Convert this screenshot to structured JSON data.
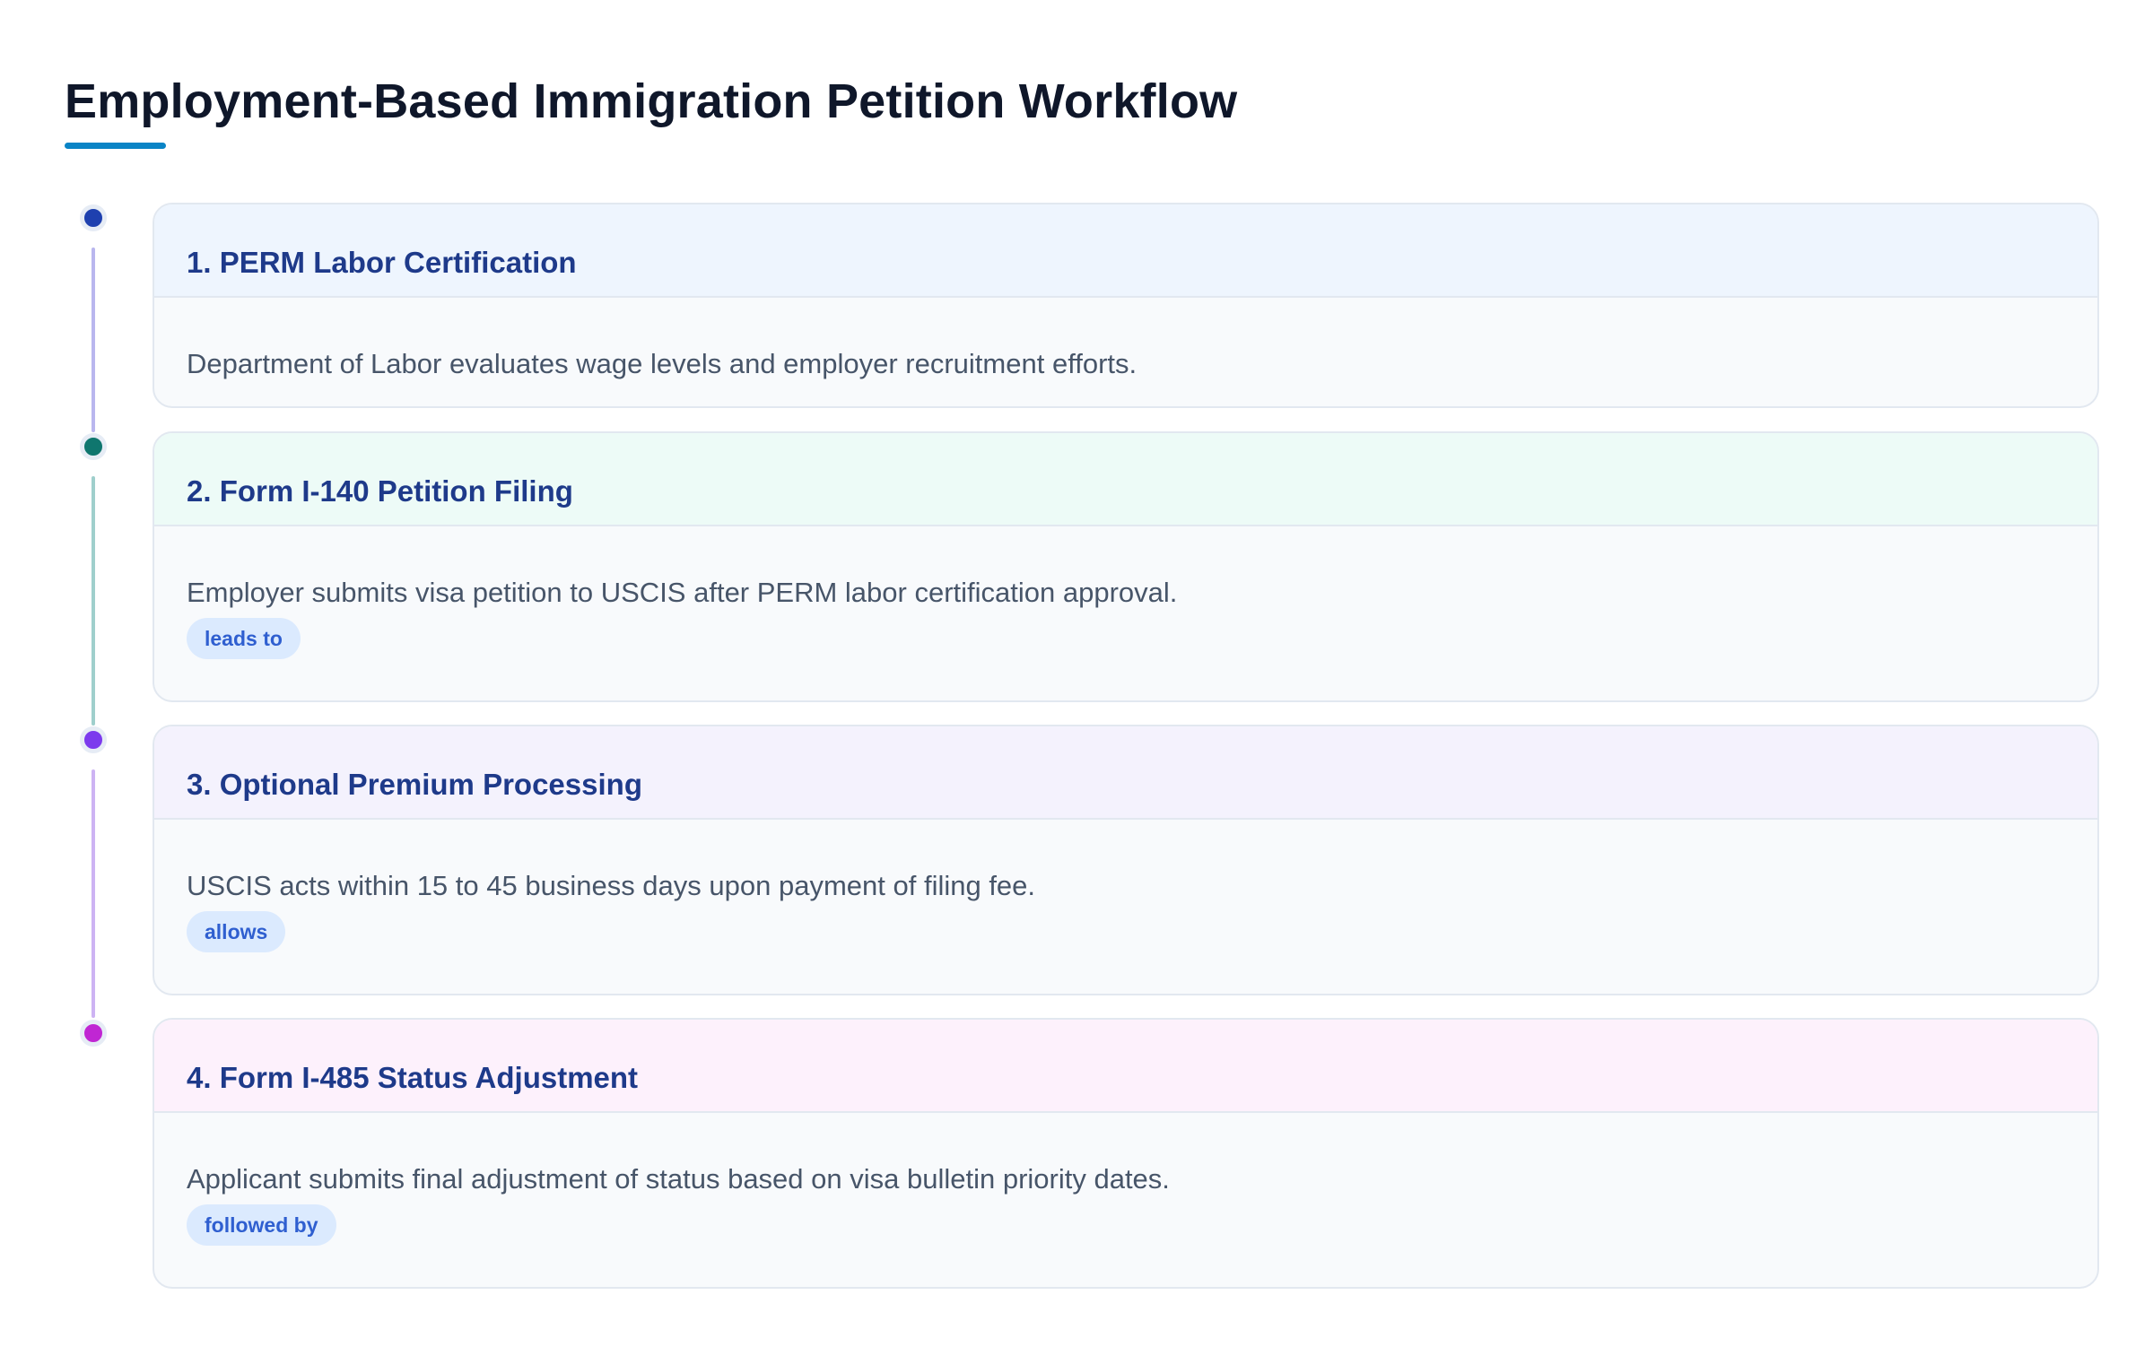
{
  "title": "Employment-Based Immigration Petition Workflow",
  "colors": {
    "accent": "#0a84c6",
    "heading": "#1e3a8a",
    "badge_bg": "#dbeafe",
    "badge_text": "#2f5fd0"
  },
  "steps": [
    {
      "title": "1. PERM Labor Certification",
      "description": "Department of Labor evaluates wage levels and employer recruitment efforts.",
      "badge": "",
      "dot_color": "#1e40af",
      "header_bg": "#eef5fe",
      "connector_color": "#b9b6ee"
    },
    {
      "title": "2. Form I-140 Petition Filing",
      "description": "Employer submits visa petition to USCIS after PERM labor certification approval.",
      "badge": "leads to",
      "dot_color": "#0f766e",
      "header_bg": "#edfbf7",
      "connector_color": "#9fcfcc"
    },
    {
      "title": "3. Optional Premium Processing",
      "description": "USCIS acts within 15 to 45 business days upon payment of filing fee.",
      "badge": "allows",
      "dot_color": "#7c3aed",
      "header_bg": "#f4f2fd",
      "connector_color": "#cdb3f3"
    },
    {
      "title": "4. Form I-485 Status Adjustment",
      "description": "Applicant submits final adjustment of status based on visa bulletin priority dates.",
      "badge": "followed by",
      "dot_color": "#c026d3",
      "header_bg": "#fdf1fc",
      "connector_color": ""
    }
  ]
}
